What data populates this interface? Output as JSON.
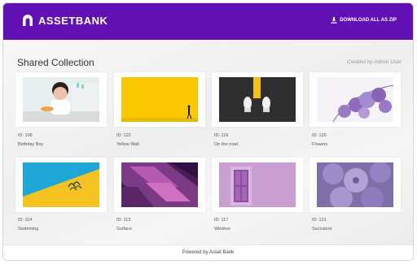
{
  "app": {
    "logo_text": "ASSETBANK",
    "download_label": "DOWNLOAD ALL AS ZIP"
  },
  "collection": {
    "title": "Shared Collection",
    "created_by": "Created by Admin User"
  },
  "assets": [
    {
      "id_label": "ID: 106",
      "name": "Birthday Boy"
    },
    {
      "id_label": "ID: 122",
      "name": "Yellow Wall"
    },
    {
      "id_label": "ID: 119",
      "name": "On the road"
    },
    {
      "id_label": "ID: 120",
      "name": "Flowers"
    },
    {
      "id_label": "ID: 114",
      "name": "Swimming"
    },
    {
      "id_label": "ID: 113",
      "name": "Surface"
    },
    {
      "id_label": "ID: 117",
      "name": "Window"
    },
    {
      "id_label": "ID: 121",
      "name": "Succulent"
    }
  ],
  "footer": {
    "text": "Powered by Asset Bank"
  },
  "colors": {
    "brand": "#6110b3",
    "background": "#f0f0f0"
  }
}
